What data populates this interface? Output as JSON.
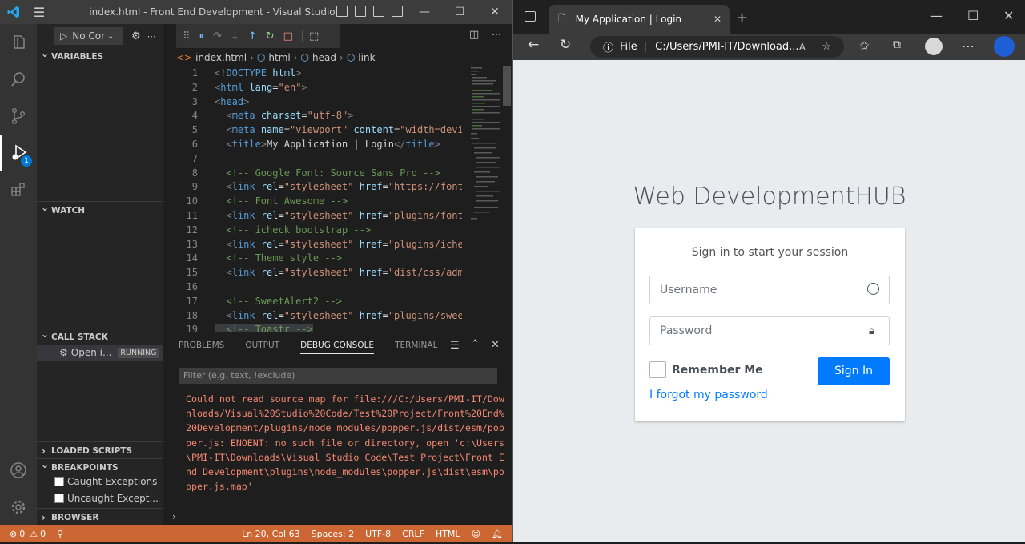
{
  "vscode": {
    "window_title": "index.html - Front End Development - Visual Studio Code",
    "run_config": "No Cor",
    "sections": {
      "variables": "VARIABLES",
      "watch": "WATCH",
      "call_stack": "CALL STACK",
      "loaded_scripts": "LOADED SCRIPTS",
      "breakpoints": "BREAKPOINTS",
      "browser_breakpoints": "BROWSER BREAKPOINTS"
    },
    "call_stack_item": {
      "label": "Open i...",
      "status": "RUNNING"
    },
    "breakpoints": [
      "Caught Exceptions",
      "Uncaught Except..."
    ],
    "debug_badge": "1",
    "breadcrumb": [
      "index.html",
      "html",
      "head",
      "link"
    ],
    "code_lines": [
      {
        "n": "1",
        "html": "<span class='br'>&lt;!</span><span class='tg'>DOCTYPE</span> <span class='at'>html</span><span class='br'>&gt;</span>"
      },
      {
        "n": "2",
        "html": "<span class='br'>&lt;</span><span class='tg'>html</span> <span class='at'>lang</span>=<span class='st'>\"en\"</span><span class='br'>&gt;</span>"
      },
      {
        "n": "3",
        "html": "<span class='br'>&lt;</span><span class='tg'>head</span><span class='br'>&gt;</span>"
      },
      {
        "n": "4",
        "html": "  <span class='br'>&lt;</span><span class='tg'>meta</span> <span class='at'>charset</span>=<span class='st'>\"utf-8\"</span><span class='br'>&gt;</span>"
      },
      {
        "n": "5",
        "html": "  <span class='br'>&lt;</span><span class='tg'>meta</span> <span class='at'>name</span>=<span class='st'>\"viewport\"</span> <span class='at'>content</span>=<span class='st'>\"width=devi</span>"
      },
      {
        "n": "6",
        "html": "  <span class='br'>&lt;</span><span class='tg'>title</span><span class='br'>&gt;</span>My Application | Login<span class='br'>&lt;/</span><span class='tg'>title</span><span class='br'>&gt;</span>"
      },
      {
        "n": "7",
        "html": ""
      },
      {
        "n": "8",
        "html": "  <span class='cm'>&lt;!-- Google Font: Source Sans Pro --&gt;</span>"
      },
      {
        "n": "9",
        "html": "  <span class='br'>&lt;</span><span class='tg'>link</span> <span class='at'>rel</span>=<span class='st'>\"stylesheet\"</span> <span class='at'>href</span>=<span class='st'>\"https://font</span>"
      },
      {
        "n": "10",
        "html": "  <span class='cm'>&lt;!-- Font Awesome --&gt;</span>"
      },
      {
        "n": "11",
        "html": "  <span class='br'>&lt;</span><span class='tg'>link</span> <span class='at'>rel</span>=<span class='st'>\"stylesheet\"</span> <span class='at'>href</span>=<span class='st'>\"plugins/font</span>"
      },
      {
        "n": "12",
        "html": "  <span class='cm'>&lt;!-- icheck bootstrap --&gt;</span>"
      },
      {
        "n": "13",
        "html": "  <span class='br'>&lt;</span><span class='tg'>link</span> <span class='at'>rel</span>=<span class='st'>\"stylesheet\"</span> <span class='at'>href</span>=<span class='st'>\"plugins/iche</span>"
      },
      {
        "n": "14",
        "html": "  <span class='cm'>&lt;!-- Theme style --&gt;</span>"
      },
      {
        "n": "15",
        "html": "  <span class='br'>&lt;</span><span class='tg'>link</span> <span class='at'>rel</span>=<span class='st'>\"stylesheet\"</span> <span class='at'>href</span>=<span class='st'>\"dist/css/adm</span>"
      },
      {
        "n": "16",
        "html": ""
      },
      {
        "n": "17",
        "html": "  <span class='cm'>&lt;!-- SweetAlert2 --&gt;</span>"
      },
      {
        "n": "18",
        "html": "  <span class='br'>&lt;</span><span class='tg'>link</span> <span class='at'>rel</span>=<span class='st'>\"stylesheet\"</span> <span class='at'>href</span>=<span class='st'>\"plugins/swee</span>"
      },
      {
        "n": "19",
        "html": "  <span class='cm'>&lt;!-- Toastr --&gt;</span>"
      }
    ],
    "panel_tabs": [
      "PROBLEMS",
      "OUTPUT",
      "DEBUG CONSOLE",
      "TERMINAL"
    ],
    "active_panel_tab": "DEBUG CONSOLE",
    "filter_placeholder": "Filter (e.g. text, !exclude)",
    "console_output": "Could not read source map for file:///C:/Users/PMI-IT/Downloads/Visual%20Studio%20Code/Test%20Project/Front%20End%20Development/plugins/node_modules/popper.js/dist/esm/popper.js: ENOENT: no such file or directory, open 'c:\\Users\\PMI-IT\\Downloads\\Visual Studio Code\\Test Project\\Front End Development\\plugins\\node_modules\\popper.js\\dist\\esm\\popper.js.map'",
    "status": {
      "errors": "0",
      "warnings": "0",
      "position": "Ln 20, Col 63",
      "spaces": "Spaces: 2",
      "encoding": "UTF-8",
      "eol": "CRLF",
      "language": "HTML"
    }
  },
  "edge": {
    "tab_title": "My Application | Login",
    "address_prefix": "File",
    "address": "C:/Users/PMI-IT/Download...",
    "login": {
      "brand_main": "Web Development",
      "brand_suffix": "HUB",
      "message": "Sign in to start your session",
      "username_placeholder": "Username",
      "password_placeholder": "Password",
      "remember": "Remember Me",
      "sign_in": "Sign In",
      "forgot": "I forgot my password"
    }
  },
  "colors": {
    "statusbar": "#cc6633",
    "primary_button": "#007bff",
    "link": "#007bff"
  }
}
